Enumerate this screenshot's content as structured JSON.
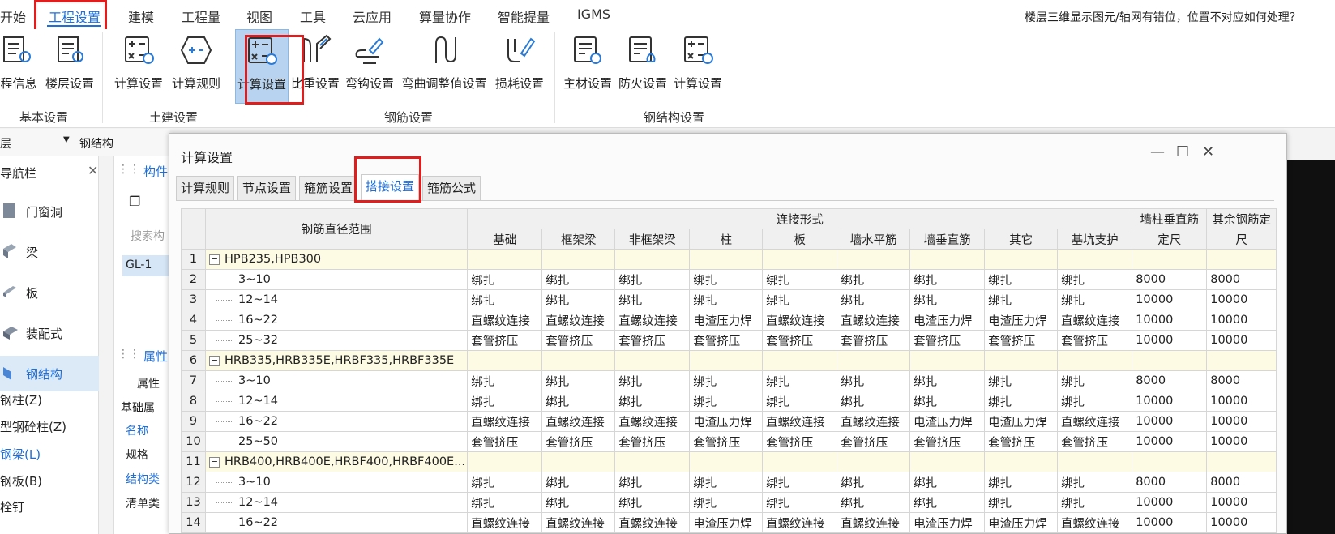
{
  "menu": {
    "items": [
      "开始",
      "工程设置",
      "建模",
      "工程量",
      "视图",
      "工具",
      "云应用",
      "算量协作",
      "智能提量",
      "IGMS"
    ],
    "active": "工程设置",
    "help": "楼层三维显示图元/轴网有错位，位置不对应如何处理？"
  },
  "ribbon": {
    "buttons": [
      "程信息",
      "楼层设置",
      "计算设置",
      "计算规则",
      "计算设置",
      "比重设置",
      "弯钩设置",
      "弯曲调整值设置",
      "损耗设置",
      "主材设置",
      "防火设置",
      "计算设置"
    ],
    "groups": [
      "基本设置",
      "土建设置",
      "钢筋设置",
      "钢结构设置"
    ]
  },
  "toolbar2": {
    "label": "钢结构"
  },
  "leftnav": {
    "title": "导航栏",
    "items": [
      "门窗洞",
      "梁",
      "板",
      "装配式",
      "钢结构"
    ],
    "subitems": [
      "钢柱(Z)",
      "型钢砼柱(Z)",
      "钢梁(L)",
      "钢板(B)",
      "栓钉"
    ]
  },
  "midpanel": {
    "tab1": "构件",
    "search": "搜索构",
    "item": "GL-1",
    "tab2": "属性",
    "prop_header": "属性",
    "prop_group": "基础属",
    "props": [
      "名称",
      "规格",
      "结构类",
      "清单类"
    ]
  },
  "dialog": {
    "title": "计算设置",
    "tabs": [
      "计算规则",
      "节点设置",
      "箍筋设置",
      "搭接设置",
      "箍筋公式"
    ],
    "active_tab": "搭接设置",
    "header": {
      "range": "钢筋直径范围",
      "connection": "连接形式",
      "cols": [
        "基础",
        "框架梁",
        "非框架梁",
        "柱",
        "板",
        "墙水平筋",
        "墙垂直筋",
        "其它",
        "基坑支护"
      ],
      "wall_fixed_1": "墙柱垂直筋",
      "wall_fixed_2": "定尺",
      "other_fixed_1": "其余钢筋定",
      "other_fixed_2": "尺"
    },
    "rows": [
      {
        "n": "1",
        "group": true,
        "label": "HPB235,HPB300"
      },
      {
        "n": "2",
        "label": "3~10",
        "vals": [
          "绑扎",
          "绑扎",
          "绑扎",
          "绑扎",
          "绑扎",
          "绑扎",
          "绑扎",
          "绑扎",
          "绑扎",
          "8000",
          "8000"
        ]
      },
      {
        "n": "3",
        "label": "12~14",
        "vals": [
          "绑扎",
          "绑扎",
          "绑扎",
          "绑扎",
          "绑扎",
          "绑扎",
          "绑扎",
          "绑扎",
          "绑扎",
          "10000",
          "10000"
        ]
      },
      {
        "n": "4",
        "label": "16~22",
        "vals": [
          "直螺纹连接",
          "直螺纹连接",
          "直螺纹连接",
          "电渣压力焊",
          "直螺纹连接",
          "直螺纹连接",
          "电渣压力焊",
          "电渣压力焊",
          "直螺纹连接",
          "10000",
          "10000"
        ]
      },
      {
        "n": "5",
        "label": "25~32",
        "vals": [
          "套管挤压",
          "套管挤压",
          "套管挤压",
          "套管挤压",
          "套管挤压",
          "套管挤压",
          "套管挤压",
          "套管挤压",
          "套管挤压",
          "10000",
          "10000"
        ]
      },
      {
        "n": "6",
        "group": true,
        "label": "HRB335,HRB335E,HRBF335,HRBF335E"
      },
      {
        "n": "7",
        "label": "3~10",
        "vals": [
          "绑扎",
          "绑扎",
          "绑扎",
          "绑扎",
          "绑扎",
          "绑扎",
          "绑扎",
          "绑扎",
          "绑扎",
          "8000",
          "8000"
        ]
      },
      {
        "n": "8",
        "label": "12~14",
        "vals": [
          "绑扎",
          "绑扎",
          "绑扎",
          "绑扎",
          "绑扎",
          "绑扎",
          "绑扎",
          "绑扎",
          "绑扎",
          "10000",
          "10000"
        ]
      },
      {
        "n": "9",
        "label": "16~22",
        "vals": [
          "直螺纹连接",
          "直螺纹连接",
          "直螺纹连接",
          "电渣压力焊",
          "直螺纹连接",
          "直螺纹连接",
          "电渣压力焊",
          "电渣压力焊",
          "直螺纹连接",
          "10000",
          "10000"
        ]
      },
      {
        "n": "10",
        "label": "25~50",
        "vals": [
          "套管挤压",
          "套管挤压",
          "套管挤压",
          "套管挤压",
          "套管挤压",
          "套管挤压",
          "套管挤压",
          "套管挤压",
          "套管挤压",
          "10000",
          "10000"
        ]
      },
      {
        "n": "11",
        "group": true,
        "label": "HRB400,HRB400E,HRBF400,HRBF400E..."
      },
      {
        "n": "12",
        "label": "3~10",
        "vals": [
          "绑扎",
          "绑扎",
          "绑扎",
          "绑扎",
          "绑扎",
          "绑扎",
          "绑扎",
          "绑扎",
          "绑扎",
          "8000",
          "8000"
        ]
      },
      {
        "n": "13",
        "label": "12~14",
        "vals": [
          "绑扎",
          "绑扎",
          "绑扎",
          "绑扎",
          "绑扎",
          "绑扎",
          "绑扎",
          "绑扎",
          "绑扎",
          "10000",
          "10000"
        ]
      },
      {
        "n": "14",
        "label": "16~22",
        "vals": [
          "直螺纹连接",
          "直螺纹连接",
          "直螺纹连接",
          "电渣压力焊",
          "直螺纹连接",
          "直螺纹连接",
          "电渣压力焊",
          "电渣压力焊",
          "直螺纹连接",
          "10000",
          "10000"
        ]
      }
    ]
  },
  "icons": {
    "ribbon": [
      "project-info-icon",
      "floor-settings-icon",
      "calc-settings-icon",
      "calc-rules-icon",
      "calc-settings-icon",
      "density-settings-icon",
      "hook-settings-icon",
      "bend-adjust-icon",
      "loss-settings-icon",
      "material-settings-icon",
      "fire-settings-icon",
      "calc-settings-icon"
    ]
  },
  "colors": {
    "accent": "#1e6fd9",
    "highlight": "#e01c1c",
    "group_row": "#fdfbe4",
    "selected_btn": "#b7d3ef"
  }
}
